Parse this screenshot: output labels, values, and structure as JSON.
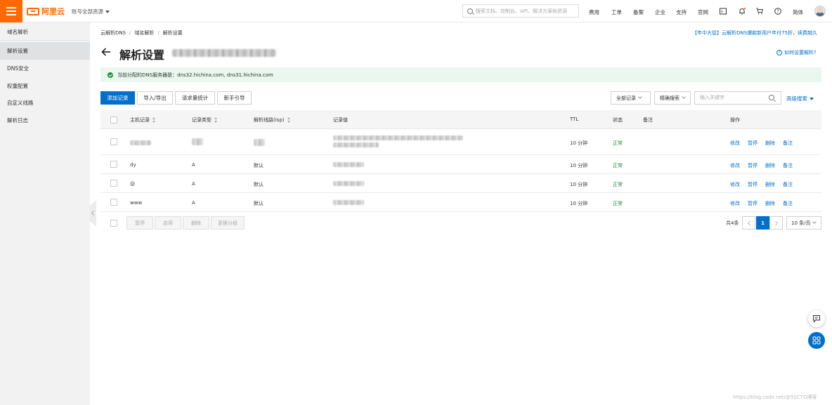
{
  "topbar": {
    "logo_text": "阿里云",
    "account_scope": "账号全部资源",
    "search_placeholder": "搜索文档、控制台、API、解决方案和资源",
    "nav": [
      "费用",
      "工单",
      "备案",
      "企业",
      "支持",
      "官网"
    ],
    "language": "简体",
    "icons": [
      "terminal-icon",
      "bell-icon",
      "cart-icon",
      "help-icon"
    ],
    "accent_color": "#ff6a00"
  },
  "sidebar": {
    "title": "域名解析",
    "items": [
      {
        "label": "解析设置",
        "active": true
      },
      {
        "label": "DNS安全",
        "active": false
      },
      {
        "label": "权重配置",
        "active": false
      },
      {
        "label": "自定义线路",
        "active": false
      },
      {
        "label": "解析日志",
        "active": false
      }
    ]
  },
  "breadcrumb": [
    "云解析DNS",
    "域名解析",
    "解析设置"
  ],
  "promo": "【年中大促】云解析DNS爆款新用户年付75折，续费越久",
  "page": {
    "title": "解析设置",
    "help_link": "如何设置解析?"
  },
  "notice": {
    "text": "当前分配的DNS服务器是：dns32.hichina.com, dns31.hichina.com"
  },
  "toolbar": {
    "add_record": "添加记录",
    "import_export": "导入/导出",
    "request_stats": "请求量统计",
    "guide": "新手引导",
    "record_filter": "全部记录",
    "search_mode": "精确搜索",
    "keyword_placeholder": "输入关键字",
    "advanced_search": "高级搜索"
  },
  "table": {
    "columns": [
      "主机记录",
      "记录类型",
      "解析线路(isp)",
      "记录值",
      "TTL",
      "状态",
      "备注",
      "操作"
    ],
    "rows": [
      {
        "host": "",
        "type": "",
        "line": "",
        "value": "",
        "ttl": "10 分钟",
        "status": "正常",
        "note": ""
      },
      {
        "host": "dy",
        "type": "A",
        "line": "默认",
        "value": "",
        "ttl": "10 分钟",
        "status": "正常",
        "note": ""
      },
      {
        "host": "@",
        "type": "A",
        "line": "默认",
        "value": "",
        "ttl": "10 分钟",
        "status": "正常",
        "note": ""
      },
      {
        "host": "www",
        "type": "A",
        "line": "默认",
        "value": "",
        "ttl": "10 分钟",
        "status": "正常",
        "note": ""
      }
    ],
    "row_actions": [
      "修改",
      "暂停",
      "删除",
      "备注"
    ],
    "status_color": "#1e8e3e"
  },
  "bulk_actions": [
    "暂停",
    "启用",
    "删除",
    "更换分组"
  ],
  "pagination": {
    "total_text": "共4条",
    "current_page": "1",
    "page_size": "10 条/页"
  },
  "watermark": "https://blog.csdn.net/@51CTO博客"
}
